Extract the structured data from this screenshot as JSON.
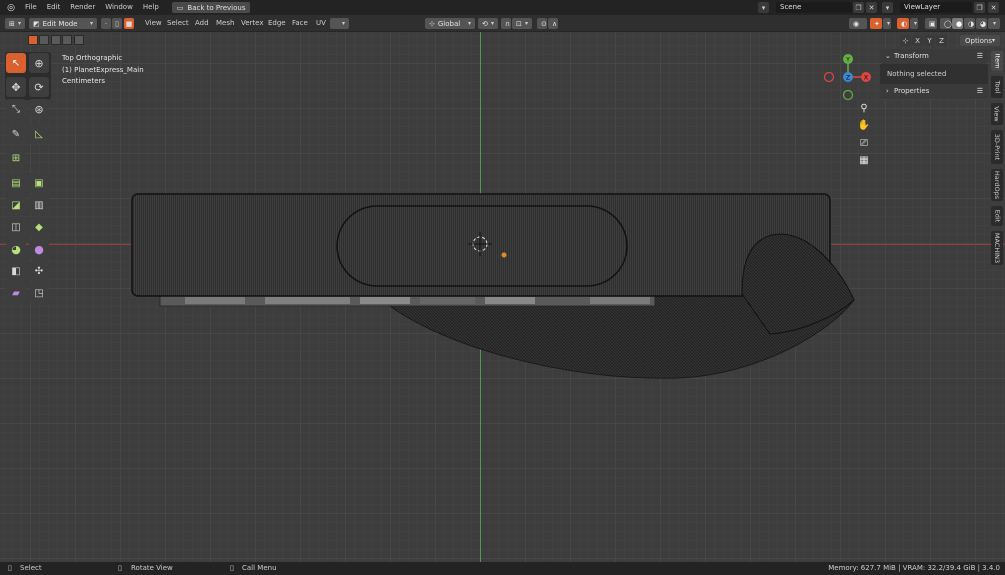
{
  "topbar": {
    "menu": [
      "File",
      "Edit",
      "Render",
      "Window",
      "Help"
    ],
    "back_button": "Back to Previous",
    "scene": "Scene",
    "view_layer": "ViewLayer"
  },
  "header": {
    "mode": "Edit Mode",
    "menus": [
      "View",
      "Select",
      "Add",
      "Mesh",
      "Vertex",
      "Edge",
      "Face",
      "UV"
    ],
    "orientation": "Global"
  },
  "options_button": "Options",
  "xyz": [
    "X",
    "Y",
    "Z"
  ],
  "viewport": {
    "view_name": "Top Orthographic",
    "object_name": "(1) PlanetExpress_Main",
    "units": "Centimeters"
  },
  "gizmo": {
    "x": "X",
    "y": "Y",
    "z": "Z"
  },
  "npanel": {
    "transform_title": "Transform",
    "transform_body": "Nothing selected",
    "properties_title": "Properties"
  },
  "sidetabs": [
    "Item",
    "Tool",
    "View",
    "3D-Print",
    "HardOps",
    "Edit",
    "MACHIN3"
  ],
  "status": {
    "select": "Select",
    "rotate": "Rotate View",
    "menu": "Call Menu",
    "memory": "Memory: 627.7 MiB | VRAM: 32.2/39.4 GiB | 3.4.0"
  },
  "colors": {
    "accent": "#d9612f",
    "axis_x": "#9b3a3a",
    "axis_y": "#4f9a4f",
    "gizmo_x": "#e04545",
    "gizmo_y": "#66b044",
    "gizmo_z": "#3b88d6"
  }
}
